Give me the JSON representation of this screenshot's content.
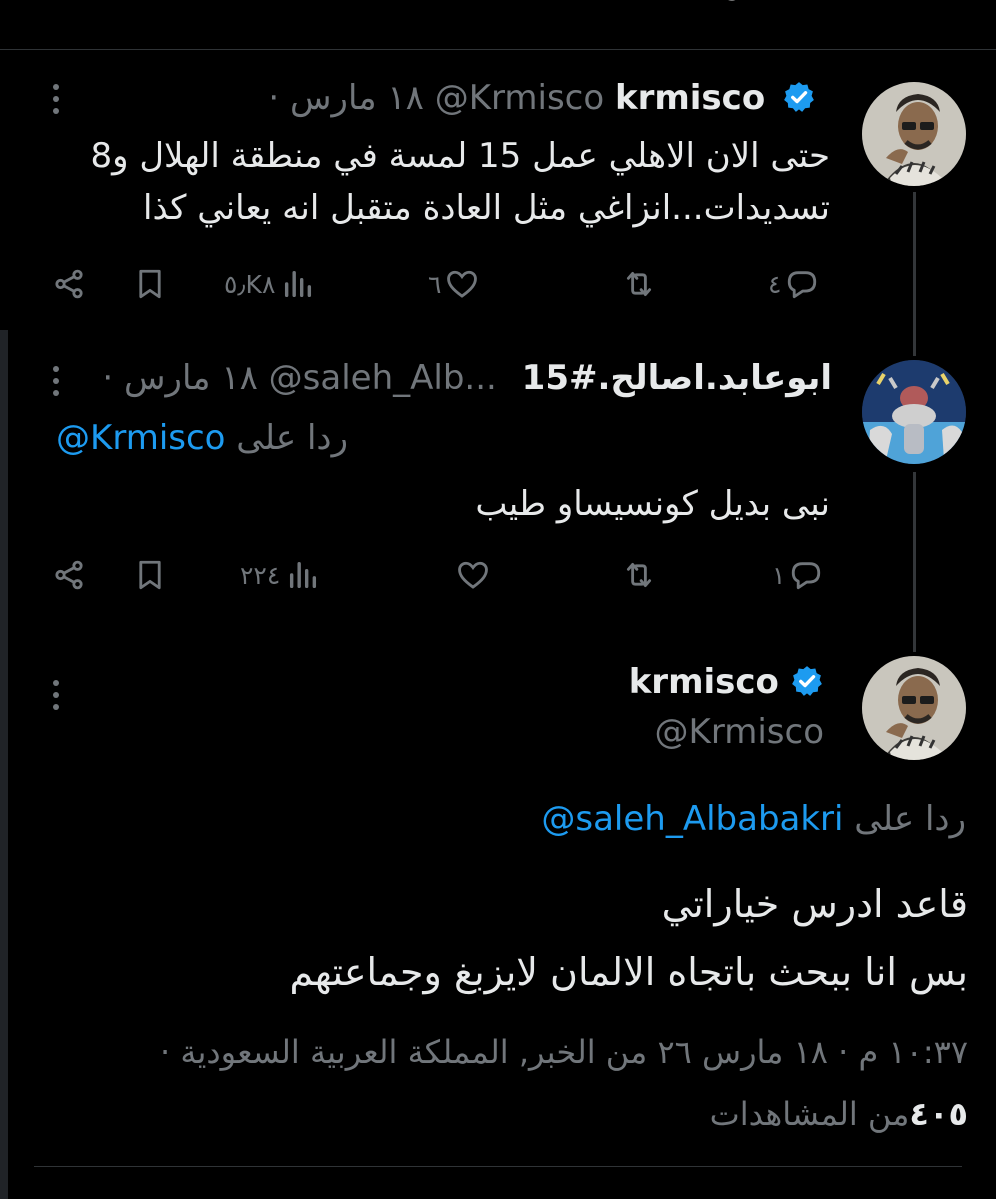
{
  "tweets": [
    {
      "display_name": "krmisco",
      "handle": "@Krmisco",
      "date_line": "· ١٨ مارس",
      "text_lines": [
        "حتى الان الاهلي عمل 15 لمسة في منطقة الهلال و8",
        "تسديدات...انزاغي مثل العادة متقبل انه يعاني كذا"
      ],
      "replies": "٤",
      "likes": "٦",
      "views": "٥٫K٨"
    },
    {
      "display_name": "ابوعابد.اصالح.#15",
      "handle": "@saleh_Alb...",
      "date_line": "· ١٨ مارس",
      "reply_prefix": "ردا على",
      "reply_to": "@Krmisco",
      "text": "نبى بديل كونسيساو طيب",
      "replies": "١",
      "views": "٢٢٤"
    }
  ],
  "main": {
    "display_name": "krmisco",
    "handle": "@Krmisco",
    "reply_prefix": "ردا على",
    "reply_to": "@saleh_Albabakri",
    "text_lines": [
      "قاعد ادرس خياراتي",
      "بس انا ببحث باتجاه الالمان لايزبغ وجماعتهم"
    ],
    "meta_line": "١٠:٣٧ م · ١٨ مارس ٢٦ من الخبر, المملكة العربية السعودية ·",
    "views_count": "٤٠٥",
    "views_label": "من المشاهدات"
  },
  "colors": {
    "background": "#000000",
    "text": "#e7e9ea",
    "muted": "#71767b",
    "link": "#1d9bf0",
    "divider": "#2f3336"
  }
}
